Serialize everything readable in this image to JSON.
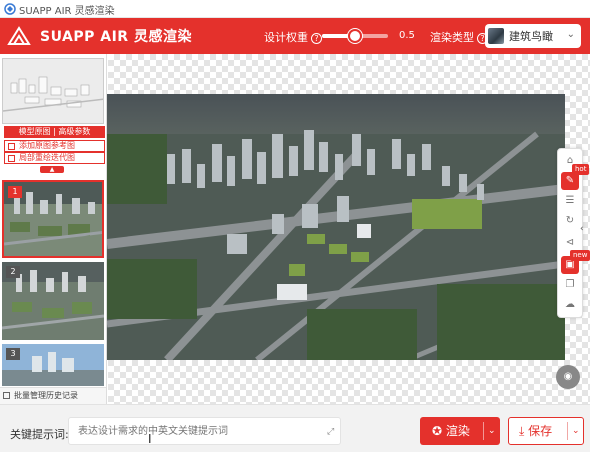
{
  "window": {
    "title": "SUAPP AIR 灵感渲染"
  },
  "header": {
    "brand": "SUAPP AIR 灵感渲染",
    "design_weight_label": "设计权重",
    "design_weight_value": "0.5",
    "design_weight_fraction": 0.5,
    "render_type_label": "渲染类型",
    "render_type_value": "建筑鸟瞰",
    "accent_color": "#e4312c"
  },
  "left_panel": {
    "tabs_label": "模型原图 | 高级参数",
    "options": [
      "添加原图参考图",
      "局部重绘迭代图"
    ],
    "history": [
      {
        "index": "1",
        "selected": true
      },
      {
        "index": "2",
        "selected": false
      },
      {
        "index": "3",
        "selected": false
      }
    ],
    "batch_label": "批量管理历史记录"
  },
  "toolbar": {
    "icons": [
      "home-icon",
      "edit-icon",
      "layers-icon",
      "rotate-icon",
      "share-icon",
      "3d-box-icon",
      "copy-icon",
      "cloud-upload-icon"
    ],
    "hot_tag": "hot",
    "new_tag": "new"
  },
  "bottom": {
    "keyword_label": "关键提示词:",
    "keyword_placeholder": "表达设计需求的中英文关键提示词",
    "render_button": "渲染",
    "save_button": "保存"
  }
}
